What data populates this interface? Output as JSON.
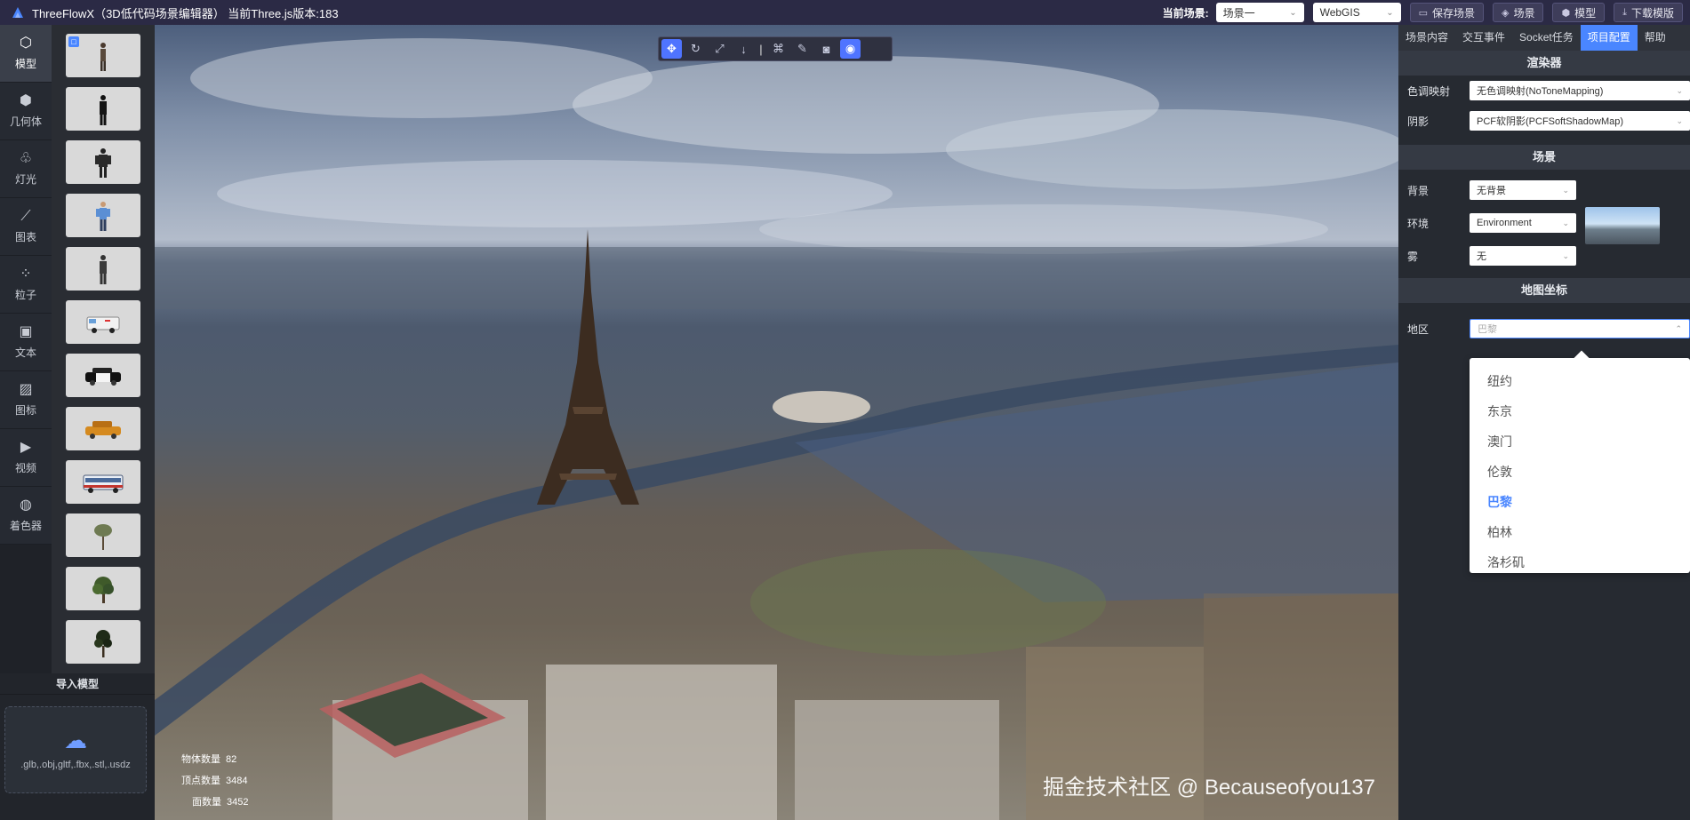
{
  "header": {
    "title": "ThreeFlowX（3D低代码场景编辑器） 当前Three.js版本:183",
    "current_scene_label": "当前场景:",
    "scene_select": "场景一",
    "mode_select": "WebGIS",
    "buttons": {
      "save": "保存场景",
      "scene": "场景",
      "model": "模型",
      "download": "下载模版"
    }
  },
  "sidebar": {
    "items": [
      {
        "label": "模型",
        "icon": "cube-icon"
      },
      {
        "label": "几何体",
        "icon": "box-icon"
      },
      {
        "label": "灯光",
        "icon": "light-icon"
      },
      {
        "label": "图表",
        "icon": "chart-icon"
      },
      {
        "label": "粒子",
        "icon": "particles-icon"
      },
      {
        "label": "文本",
        "icon": "text-icon"
      },
      {
        "label": "图标",
        "icon": "image-icon"
      },
      {
        "label": "视频",
        "icon": "video-icon"
      },
      {
        "label": "着色器",
        "icon": "palette-icon"
      }
    ],
    "active_index": 0
  },
  "model_thumbnails": [
    "figure-1",
    "figure-2",
    "figure-3",
    "figure-4",
    "figure-5",
    "ambulance",
    "police-car",
    "taxi",
    "bus",
    "tree-1",
    "tree-2",
    "tree-3"
  ],
  "import_panel": {
    "title": "导入模型",
    "hint": ".glb,.obj,gltf,.fbx,.stl,.usdz"
  },
  "viewport": {
    "stats": {
      "objects_label": "物体数量",
      "objects_value": "82",
      "vertices_label": "顶点数量",
      "vertices_value": "3484",
      "faces_label": "面数量",
      "faces_value": "3452"
    },
    "watermark": "掘金技术社区 @ Becauseofyou137"
  },
  "right_panel": {
    "tabs": [
      "场景内容",
      "交互事件",
      "Socket任务",
      "项目配置",
      "帮助"
    ],
    "active_tab_index": 3,
    "renderer": {
      "title": "渲染器",
      "tone_mapping_label": "色调映射",
      "tone_mapping_value": "无色调映射(NoToneMapping)",
      "shadow_label": "阴影",
      "shadow_value": "PCF软阴影(PCFSoftShadowMap)"
    },
    "scene": {
      "title": "场景",
      "background_label": "背景",
      "background_value": "无背景",
      "environment_label": "环境",
      "environment_value": "Environment",
      "fog_label": "雾",
      "fog_value": "无"
    },
    "map": {
      "title": "地图坐标",
      "region_label": "地区",
      "region_placeholder": "巴黎",
      "options": [
        "纽约",
        "东京",
        "澳门",
        "伦敦",
        "巴黎",
        "柏林",
        "洛杉矶"
      ],
      "selected_index": 4
    }
  },
  "colors": {
    "accent": "#4a86ff",
    "topbar": "#2b2a45",
    "panel": "#262a31"
  }
}
